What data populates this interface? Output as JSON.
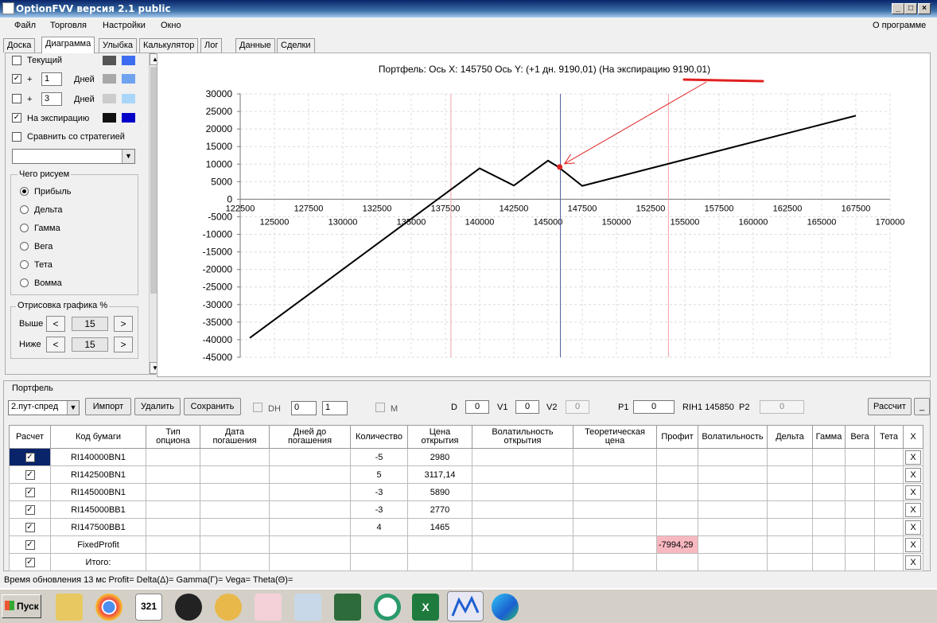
{
  "window": {
    "title": "OptionFVV версия 2.1 public"
  },
  "menu": {
    "items": [
      "Файл",
      "Торговля",
      "Настройки",
      "Окно"
    ],
    "about": "О программе"
  },
  "tabs": [
    "Доска",
    "Диаграмма",
    "Улыбка",
    "Калькулятор",
    "Лог",
    "Данные",
    "Сделки"
  ],
  "left": {
    "current": {
      "label": "Текущий",
      "checked": false,
      "colors": [
        "#555555",
        "#3d6cf0"
      ]
    },
    "plus1": {
      "sign": "+",
      "days": "1",
      "label": "Дней",
      "checked": true,
      "colors": [
        "#a8a8a8",
        "#6fa3f0"
      ]
    },
    "plus2": {
      "sign": "+",
      "days": "3",
      "label": "Дней",
      "checked": false,
      "colors": [
        "#cccccc",
        "#a9d6f8"
      ]
    },
    "expiry": {
      "label": "На экспирацию",
      "checked": true,
      "colors": [
        "#111111",
        "#0000c8"
      ]
    },
    "compare": {
      "label": "Сравнить со стратегией",
      "checked": false
    },
    "draw_group": {
      "title": "Чего рисуем",
      "options": [
        "Прибыль",
        "Дельта",
        "Гамма",
        "Вега",
        "Тета",
        "Вомма"
      ],
      "selected": 0
    },
    "render_group": {
      "title": "Отрисовка графика %",
      "above_label": "Выше",
      "above_value": "15",
      "below_label": "Ниже",
      "below_value": "15",
      "dec": "<",
      "inc": ">"
    }
  },
  "chart_data": {
    "type": "line",
    "title": "Портфель:  Ось X:  145750 Ось Y:  (+1 дн. 9190,01)  (На экспирацию 9190,01)",
    "ylim": [
      -45000,
      30000
    ],
    "xlim": [
      122500,
      170000
    ],
    "yticks": [
      "30000",
      "25000",
      "20000",
      "15000",
      "10000",
      "5000",
      "0",
      "-5000",
      "-10000",
      "-15000",
      "-20000",
      "-25000",
      "-30000",
      "-35000",
      "-40000",
      "-45000"
    ],
    "ytick_values": [
      30000,
      25000,
      20000,
      15000,
      10000,
      5000,
      0,
      -5000,
      -10000,
      -15000,
      -20000,
      -25000,
      -30000,
      -35000,
      -40000,
      -45000
    ],
    "xticks_upper": [
      "122500",
      "127500",
      "132500",
      "137500",
      "142500",
      "147500",
      "152500",
      "157500",
      "162500",
      "167500"
    ],
    "xtick_upper_values": [
      122500,
      127500,
      132500,
      137500,
      142500,
      147500,
      152500,
      157500,
      162500,
      167500
    ],
    "xticks_lower": [
      "125000",
      "130000",
      "135000",
      "140000",
      "145000",
      "150000",
      "155000",
      "160000",
      "165000",
      "170000"
    ],
    "xtick_lower_values": [
      125000,
      130000,
      135000,
      140000,
      145000,
      150000,
      155000,
      160000,
      165000,
      170000
    ],
    "series": [
      {
        "color": "#000000",
        "x": [
          123200,
          140000,
          142500,
          145000,
          145750,
          147500,
          167500
        ],
        "y": [
          -39500,
          8800,
          3900,
          11000,
          9190,
          3800,
          23800
        ]
      }
    ],
    "vlines": [
      {
        "x": 137900,
        "color": "#f2a0a8"
      },
      {
        "x": 145900,
        "color": "#5060a8"
      },
      {
        "x": 153800,
        "color": "#f2a0a8"
      }
    ],
    "marker": {
      "x": 145850,
      "y": 9190,
      "color": "#e02020"
    },
    "grid": true
  },
  "portfolio": {
    "title": "Портфель",
    "strategy": "2.пут-спред",
    "buttons": {
      "import": "Импорт",
      "delete": "Удалить",
      "save": "Сохранить",
      "calc": "Рассчит",
      "minimize": "_"
    },
    "dh_label": "DH",
    "dh_val1": "0",
    "dh_val2": "1",
    "m_label": "M",
    "d_label": "D",
    "d_val": "0",
    "v1_label": "V1",
    "v1_val": "0",
    "v2_label": "V2",
    "v2_val": "0",
    "p1_label": "P1",
    "p1_val": "0",
    "rih_label": "RIH1 145850",
    "p2_label": "P2",
    "p2_val": "0",
    "columns": [
      "Расчет",
      "Код бумаги",
      "Тип опциона",
      "Дата погашения",
      "Дней до погашения",
      "Количество",
      "Цена открытия",
      "Волатильность открытия",
      "Теоретическая цена",
      "Профит",
      "Волатильность",
      "Дельта",
      "Гамма",
      "Вега",
      "Тета",
      "X"
    ],
    "rows": [
      {
        "code": "RI140000BN1",
        "qty": "-5",
        "price": "2980",
        "profit": ""
      },
      {
        "code": "RI142500BN1",
        "qty": "5",
        "price": "3117,14",
        "profit": ""
      },
      {
        "code": "RI145000BN1",
        "qty": "-3",
        "price": "5890",
        "profit": ""
      },
      {
        "code": "RI145000BB1",
        "qty": "-3",
        "price": "2770",
        "profit": ""
      },
      {
        "code": "RI147500BB1",
        "qty": "4",
        "price": "1465",
        "profit": ""
      },
      {
        "code": "FixedProfit",
        "qty": "",
        "price": "",
        "profit": "-7994,29"
      },
      {
        "code": "Итого:",
        "qty": "",
        "price": "",
        "profit": ""
      }
    ],
    "row_delete": "X"
  },
  "status": {
    "text": "Время обновления 13 мс  Profit= Delta(Δ)= Gamma(Γ)= Vega= Theta(Θ)="
  },
  "taskbar": {
    "start": "Пуск"
  }
}
